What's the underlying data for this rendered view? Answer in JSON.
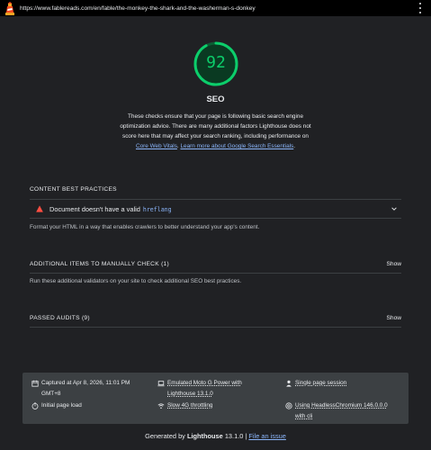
{
  "browser": {
    "url": "https://www.fablereads.com/en/fable/the-monkey-the-shark-and-the-washerman-s-donkey"
  },
  "score": {
    "value": 92,
    "fraction": 0.92,
    "title": "SEO",
    "color": "#0cce6b"
  },
  "description": {
    "text1": "These checks ensure that your page is following basic search engine optimization advice. There are many additional factors Lighthouse does not score here that may affect your search ranking, including performance on ",
    "link1": "Core Web Vitals",
    "text2": ". ",
    "link2": "Learn more about Google Search Essentials",
    "text3": "."
  },
  "sections": {
    "content_best_practices": {
      "title": "CONTENT BEST PRACTICES",
      "audit_title": "Document doesn't have a valid",
      "audit_code": "hreflang",
      "help": "Format your HTML in a way that enables crawlers to better understand your app's content."
    },
    "manual_checks": {
      "title": "ADDITIONAL ITEMS TO MANUALLY CHECK (1)",
      "show": "Show",
      "help": "Run these additional validators on your site to check additional SEO best practices."
    },
    "passed_audits": {
      "title": "PASSED AUDITS (9)",
      "show": "Show"
    }
  },
  "footer": {
    "captured": "Captured at Apr 8, 2026, 11:01 PM GMT+8",
    "page_load": "Initial page load",
    "device": "Emulated Moto G Power with Lighthouse 13.1.0",
    "throttling": "Slow 4G throttling",
    "session": "Single page session",
    "browser": "Using HeadlessChromium 146.0.0.0 with cli"
  },
  "generated": {
    "prefix": "Generated by ",
    "product": "Lighthouse",
    "version": " 13.1.0 | ",
    "issue_link": "File an issue"
  }
}
